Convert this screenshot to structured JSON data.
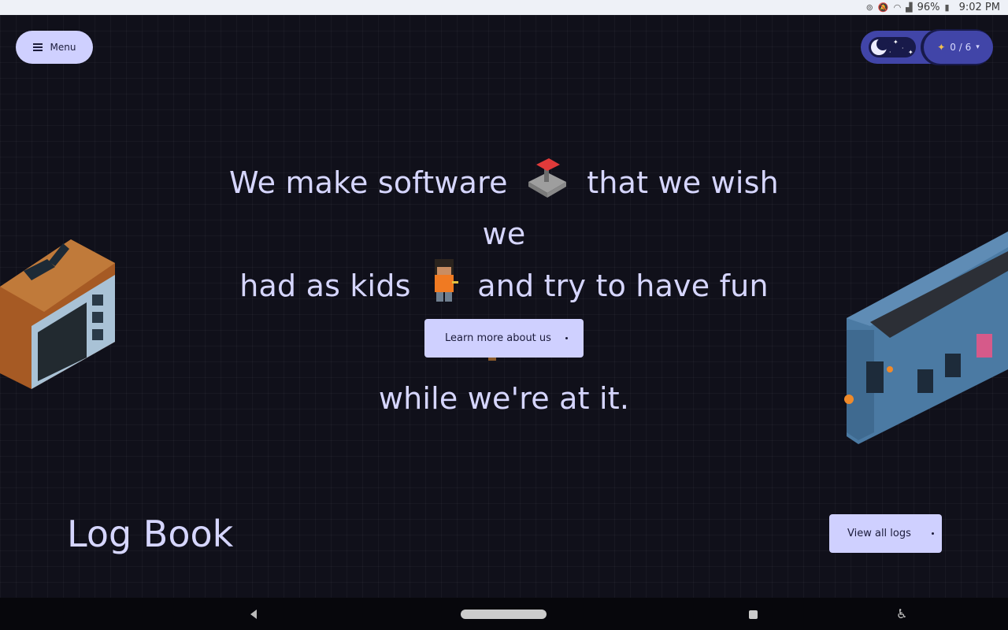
{
  "status_bar": {
    "battery": "96%",
    "time": "9:02 PM"
  },
  "header": {
    "menu_label": "Menu",
    "counter_label": "0 / 6"
  },
  "hero": {
    "line_1": "We make software",
    "line_2": "that we wish we",
    "line_3": "had as kids",
    "line_4": "and try to have fun",
    "line_5": "while we're at it.",
    "cta_label": "Learn more about us"
  },
  "logbook": {
    "title": "Log Book",
    "view_all_label": "View all logs"
  },
  "icons": {
    "menu": "hamburger-icon",
    "theme": "moon-icon",
    "counter": "sparkle-icon",
    "hero_emojis": [
      "joystick-icon",
      "kid-character-icon",
      "slingshot-icon"
    ],
    "decor": [
      "retro-tv-icon",
      "train-icon"
    ]
  },
  "colors": {
    "background": "#10101a",
    "accent": "#cfd0ff",
    "pill": "#4145a8",
    "text": "#d6d6ff"
  }
}
